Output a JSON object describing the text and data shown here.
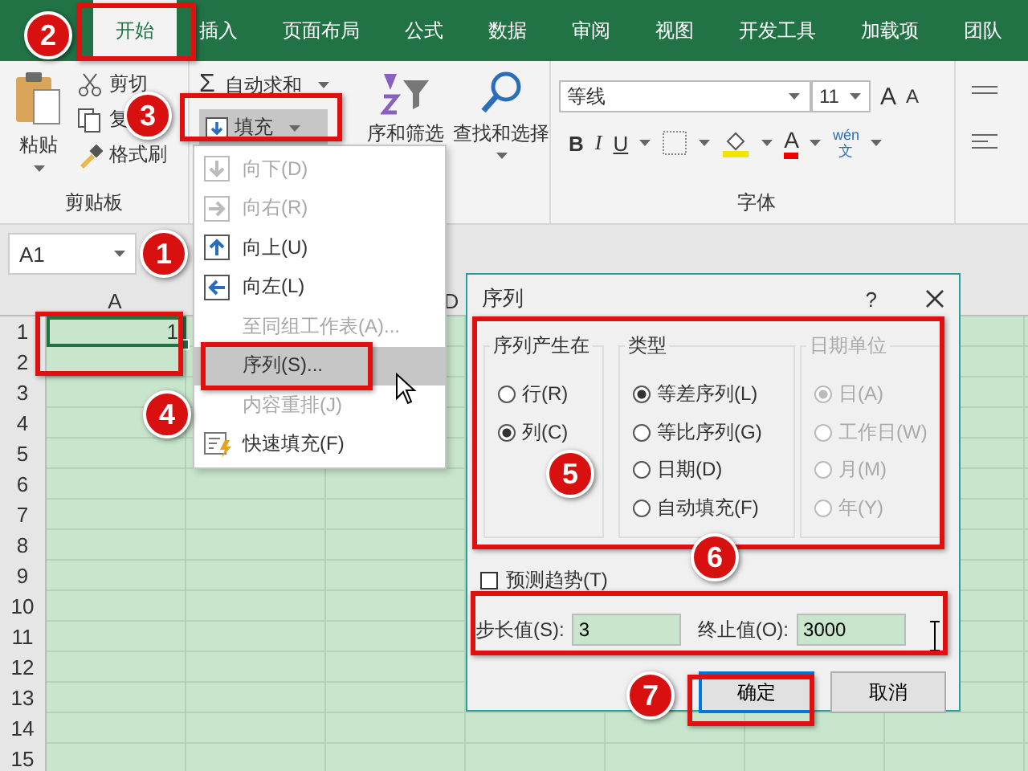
{
  "ribbon_tabs": [
    {
      "label": "开始",
      "selected": true
    },
    {
      "label": "插入",
      "selected": false
    },
    {
      "label": "页面布局",
      "selected": false
    },
    {
      "label": "公式",
      "selected": false
    },
    {
      "label": "数据",
      "selected": false
    },
    {
      "label": "审阅",
      "selected": false
    },
    {
      "label": "视图",
      "selected": false
    },
    {
      "label": "开发工具",
      "selected": false
    },
    {
      "label": "加载项",
      "selected": false
    },
    {
      "label": "团队",
      "selected": false
    }
  ],
  "clipboard_group": {
    "paste": "粘贴",
    "cut": "剪切",
    "copy": "复",
    "format_painter": "格式刷",
    "label": "剪贴板"
  },
  "editing_group": {
    "autosum_sign": "Σ",
    "autosum": "自动求和",
    "fill": "填充",
    "sort_filter": "序和筛选",
    "find_select": "查找和选择"
  },
  "font_group": {
    "font_name": "等线",
    "font_size": "11",
    "grow_font": "A",
    "shrink_font": "A",
    "bold": "B",
    "italic": "I",
    "underline": "U",
    "font_color": "A",
    "phonetic_top": "wén",
    "phonetic_bottom": "文",
    "label": "字体"
  },
  "name_box": "A1",
  "sheet": {
    "columns": [
      "A",
      "D"
    ],
    "rows": [
      "1",
      "2",
      "3",
      "4",
      "5",
      "6",
      "7",
      "8",
      "9",
      "10",
      "11",
      "12",
      "13",
      "14",
      "15"
    ],
    "cell_a1": "1"
  },
  "fill_menu": [
    {
      "kind": "down",
      "label": "向下(D)",
      "disabled": true,
      "selected": false
    },
    {
      "kind": "right",
      "label": "向右(R)",
      "disabled": true,
      "selected": false
    },
    {
      "kind": "up",
      "label": "向上(U)",
      "disabled": false,
      "selected": false
    },
    {
      "kind": "left",
      "label": "向左(L)",
      "disabled": false,
      "selected": false
    },
    {
      "kind": "plain",
      "label": "至同组工作表(A)...",
      "disabled": true,
      "selected": false
    },
    {
      "kind": "plain",
      "label": "序列(S)...",
      "disabled": false,
      "selected": true
    },
    {
      "kind": "plain",
      "label": "内容重排(J)",
      "disabled": true,
      "selected": false
    },
    {
      "kind": "flash",
      "label": "快速填充(F)",
      "disabled": false,
      "selected": false
    }
  ],
  "dialog": {
    "title": "序列",
    "help": "?",
    "groups": [
      {
        "title": "序列产生在",
        "disabled": false,
        "options": [
          {
            "label": "行(R)",
            "selected": false
          },
          {
            "label": "列(C)",
            "selected": true
          }
        ]
      },
      {
        "title": "类型",
        "disabled": false,
        "options": [
          {
            "label": "等差序列(L)",
            "selected": true
          },
          {
            "label": "等比序列(G)",
            "selected": false
          },
          {
            "label": "日期(D)",
            "selected": false
          },
          {
            "label": "自动填充(F)",
            "selected": false
          }
        ]
      },
      {
        "title": "日期单位",
        "disabled": true,
        "options": [
          {
            "label": "日(A)",
            "selected": true
          },
          {
            "label": "工作日(W)",
            "selected": false
          },
          {
            "label": "月(M)",
            "selected": false
          },
          {
            "label": "年(Y)",
            "selected": false
          }
        ]
      }
    ],
    "trend": {
      "label": "预测趋势(T)",
      "checked": false
    },
    "step": {
      "label": "步长值(S):",
      "value": "3"
    },
    "stop": {
      "label": "终止值(O):",
      "value": "3000"
    },
    "buttons": [
      {
        "label": "确定",
        "default": true
      },
      {
        "label": "取消",
        "default": false
      }
    ]
  },
  "callouts": [
    "1",
    "2",
    "3",
    "4",
    "5",
    "6",
    "7"
  ]
}
